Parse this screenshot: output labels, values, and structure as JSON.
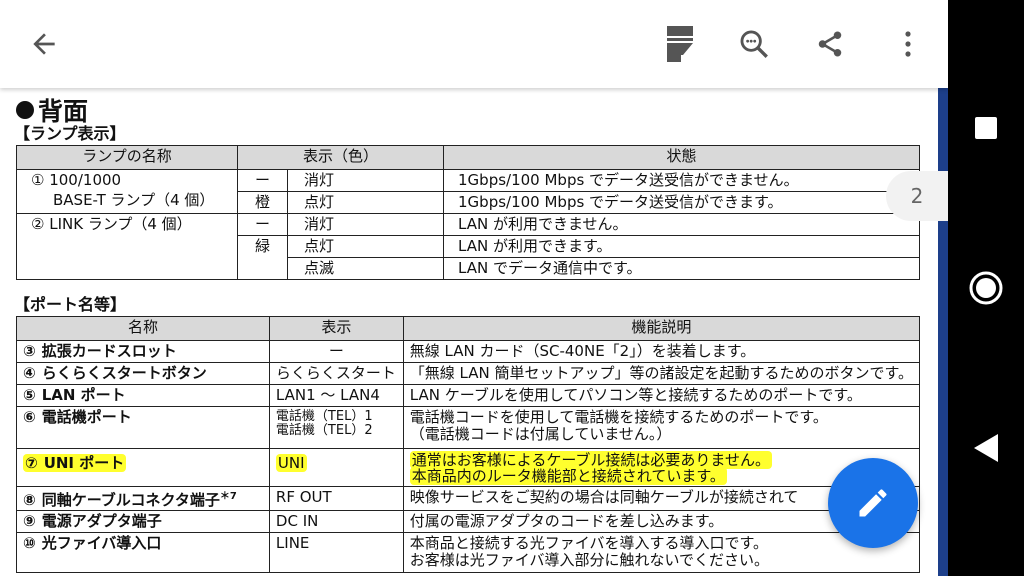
{
  "colors": {
    "accent": "#1a73e8",
    "highlight": "#ffff2e",
    "header_bg": "#d9d9d9"
  },
  "toolbar": {
    "back_icon": "arrow-back-icon",
    "doc_icon": "document-icon",
    "search_icon": "zoom-search-icon",
    "share_icon": "share-icon",
    "more_icon": "more-vertical-icon"
  },
  "page_number": "2",
  "doc": {
    "title": "背面",
    "lamp_section": "【ランプ表示】",
    "lamp_headers": [
      "ランプの名称",
      "表示（色）",
      "状態"
    ],
    "lamp_rows": [
      {
        "name1": "① 100/1000",
        "name2": "BASE-T ランプ（4 個）",
        "color": "ー",
        "disp": "消灯",
        "state": "1Gbps/100 Mbps でデータ送受信ができません。"
      },
      {
        "color": "橙",
        "disp": "点灯",
        "state": "1Gbps/100 Mbps でデータ送受信ができます。"
      },
      {
        "name1": "② LINK ランプ（4 個）",
        "color": "ー",
        "disp": "消灯",
        "state": "LAN が利用できません。"
      },
      {
        "color": "緑",
        "disp": "点灯",
        "state": "LAN が利用できます。"
      },
      {
        "disp": "点滅",
        "state": "LAN でデータ通信中です。"
      }
    ],
    "port_section": "【ポート名等】",
    "port_headers": [
      "名称",
      "表示",
      "機能説明"
    ],
    "port_rows": [
      {
        "num": "③",
        "name": "拡張カードスロット",
        "disp": "ー",
        "desc": "無線 LAN カード（SC-40NE「2」）を装着します。"
      },
      {
        "num": "④",
        "name": "らくらくスタートボタン",
        "disp": "らくらくスタート",
        "desc": "「無線 LAN 簡単セットアップ」等の諸設定を起動するためのボタンです。"
      },
      {
        "num": "⑤",
        "name": "LAN ポート",
        "disp": "LAN1 ～ LAN4",
        "desc": "LAN ケーブルを使用してパソコン等と接続するためのポートです。"
      },
      {
        "num": "⑥",
        "name": "電話機ポート",
        "disp": "電話機（TEL）1",
        "disp2": "電話機（TEL）2",
        "desc": "電話機コードを使用して電話機を接続するためのポートです。",
        "desc2": "（電話機コードは付属していません。）"
      },
      {
        "num": "⑦",
        "name": "UNI ポート",
        "disp": "UNI",
        "desc": "通常はお客様によるケーブル接続は必要ありません。",
        "desc2": "本商品内のルータ機能部と接続されています。"
      },
      {
        "num": "⑧",
        "name": "同軸ケーブルコネクタ端子",
        "sup": "＊7",
        "disp": "RF OUT",
        "desc": "映像サービスをご契約の場合は同軸ケーブルが接続されて"
      },
      {
        "num": "⑨",
        "name": "電源アダプタ端子",
        "disp": "DC IN",
        "desc": "付属の電源アダプタのコードを差し込みます。"
      },
      {
        "num": "⑩",
        "name": "光ファイバ導入口",
        "disp": "LINE",
        "desc": "本商品と接続する光ファイバを導入する導入口です。",
        "desc2": "お客様は光ファイバ導入部分に触れないでください。"
      }
    ]
  },
  "fab_icon": "edit-pencil-icon",
  "navbar": {
    "recent_icon": "recents-square-icon",
    "home_icon": "home-circle-icon",
    "back_icon": "back-triangle-icon"
  }
}
